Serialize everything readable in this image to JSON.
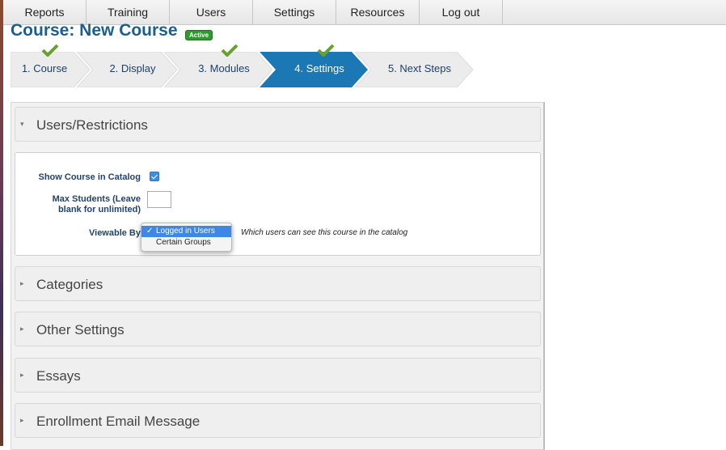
{
  "nav": {
    "items": [
      "Reports",
      "Training",
      "Users",
      "Settings",
      "Resources",
      "Log out"
    ]
  },
  "page": {
    "title": "Course: New Course",
    "status_badge": "Active"
  },
  "steps": [
    {
      "label": "1. Course",
      "completed": true
    },
    {
      "label": "2. Display",
      "completed": false
    },
    {
      "label": "3. Modules",
      "completed": true
    },
    {
      "label": "4. Settings",
      "completed": true,
      "current": true
    },
    {
      "label": "5. Next Steps",
      "completed": false
    }
  ],
  "sections": {
    "users_restrictions": {
      "title": "Users/Restrictions",
      "expanded": true,
      "show_in_catalog_label": "Show Course in Catalog",
      "show_in_catalog_checked": true,
      "max_students_label_line1": "Max Students (Leave",
      "max_students_label_line2": "blank for unlimited)",
      "max_students_value": "",
      "viewable_by_label": "Viewable By",
      "viewable_by_options": [
        "Logged in Users",
        "Certain Groups"
      ],
      "viewable_by_selected": "Logged in Users",
      "viewable_by_check": "✓",
      "viewable_by_help": "Which users can see this course in the catalog"
    },
    "categories": {
      "title": "Categories"
    },
    "other_settings": {
      "title": "Other Settings"
    },
    "essays": {
      "title": "Essays"
    },
    "enrollment_email": {
      "title": "Enrollment Email Message"
    }
  },
  "colors": {
    "accent": "#1b78b4",
    "title": "#1b5f8c",
    "badge": "#2d9a2d",
    "step_inactive": "#ececec",
    "check_green": "#6aa02e"
  },
  "icons": {
    "collapsed": "right-triangle",
    "expanded": "down-triangle",
    "step_complete": "checkmark"
  }
}
